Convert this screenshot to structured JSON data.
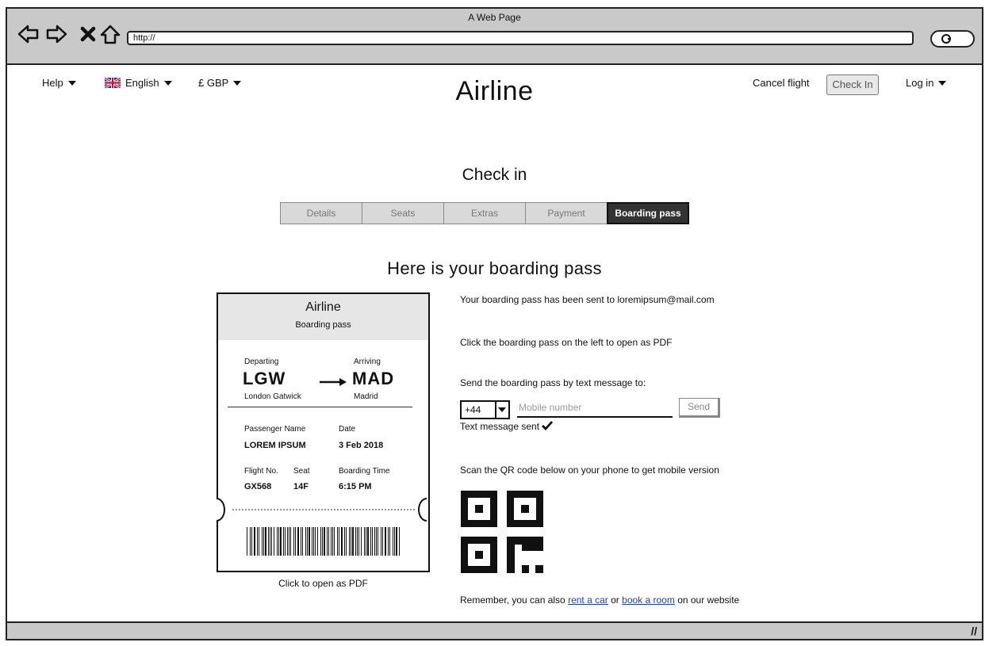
{
  "window": {
    "title": "A Web Page",
    "url": "http://"
  },
  "header": {
    "help": "Help",
    "language": "English",
    "currency": "£ GBP",
    "brand": "Airline",
    "cancel_flight": "Cancel flight",
    "check_in": "Check In",
    "log_in": "Log in"
  },
  "page": {
    "title": "Check in",
    "section_title": "Here is your boarding pass"
  },
  "steps": [
    "Details",
    "Seats",
    "Extras",
    "Payment",
    "Boarding pass"
  ],
  "active_step": "Boarding pass",
  "pass": {
    "airline": "Airline",
    "subtitle": "Boarding pass",
    "departing_label": "Departing",
    "arriving_label": "Arriving",
    "from_code": "LGW",
    "to_code": "MAD",
    "from_name": "London Gatwick",
    "to_name": "Madrid",
    "passenger_label": "Passenger Name",
    "passenger": "LOREM IPSUM",
    "date_label": "Date",
    "date": "3 Feb 2018",
    "flight_label": "Flight No.",
    "flight": "GX568",
    "seat_label": "Seat",
    "seat": "14F",
    "boarding_label": "Boarding Time",
    "boarding_time": "6:15 PM",
    "caption": "Click to open as PDF"
  },
  "info": {
    "sent": "Your boarding pass has been sent to loremipsum@mail.com",
    "click_pdf": "Click the boarding pass on the left to open as PDF",
    "send_sms": "Send the boarding pass by text message to:",
    "country_code": "+44",
    "mobile_placeholder": "Mobile number",
    "send": "Send",
    "sms_sent": "Text message sent",
    "qr_text": "Scan the QR code below on your phone to get mobile version",
    "remember_pre": "Remember, you can also",
    "rent_car": "rent a car",
    "or": "or",
    "book_room": "book a room",
    "remember_post": "on our website"
  },
  "icons": {
    "back": "left-arrow-icon",
    "forward": "right-arrow-icon",
    "stop": "close-icon",
    "home": "home-icon",
    "search": "search-icon",
    "flag": "uk-flag-icon",
    "arrow": "right-long-arrow-icon",
    "check": "checkmark-icon",
    "dropdown": "caret-down-icon",
    "qr": "qr-code-icon",
    "barcode": "barcode-icon"
  }
}
